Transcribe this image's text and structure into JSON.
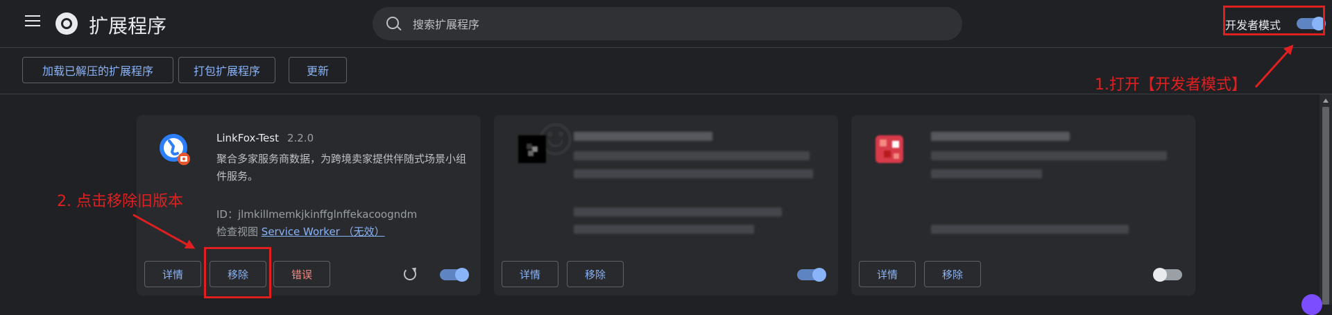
{
  "header": {
    "title": "扩展程序",
    "search_placeholder": "搜索扩展程序",
    "dev_mode_label": "开发者模式",
    "dev_mode_on": true
  },
  "toolbar": {
    "load_unpacked": "加载已解压的扩展程序",
    "pack": "打包扩展程序",
    "update": "更新"
  },
  "cards": [
    {
      "name": "LinkFox-Test",
      "version": "2.2.0",
      "description": "聚合多家服务商数据，为跨境卖家提供伴随式场景小组件服务。",
      "id_line": "ID：jlmkillmemkjkinffglnffekacoogndm",
      "inspect_label": "检查视图",
      "inspect_link": "Service Worker （无效）",
      "details": "详情",
      "remove": "移除",
      "errors": "错误",
      "enabled": true,
      "icon": "linkfox-icon"
    },
    {
      "details": "详情",
      "remove": "移除",
      "enabled": true,
      "icon": "blurred-icon"
    },
    {
      "details": "详情",
      "remove": "移除",
      "enabled": false,
      "icon": "blurred-icon"
    }
  ],
  "annotations": {
    "step1": "1.打开【开发者模式】",
    "step2": "2. 点击移除旧版本"
  },
  "colors": {
    "background": "#202124",
    "card": "#292a2d",
    "accent": "#8ab4f8",
    "annotation": "#e02020",
    "error": "#f28b82"
  }
}
